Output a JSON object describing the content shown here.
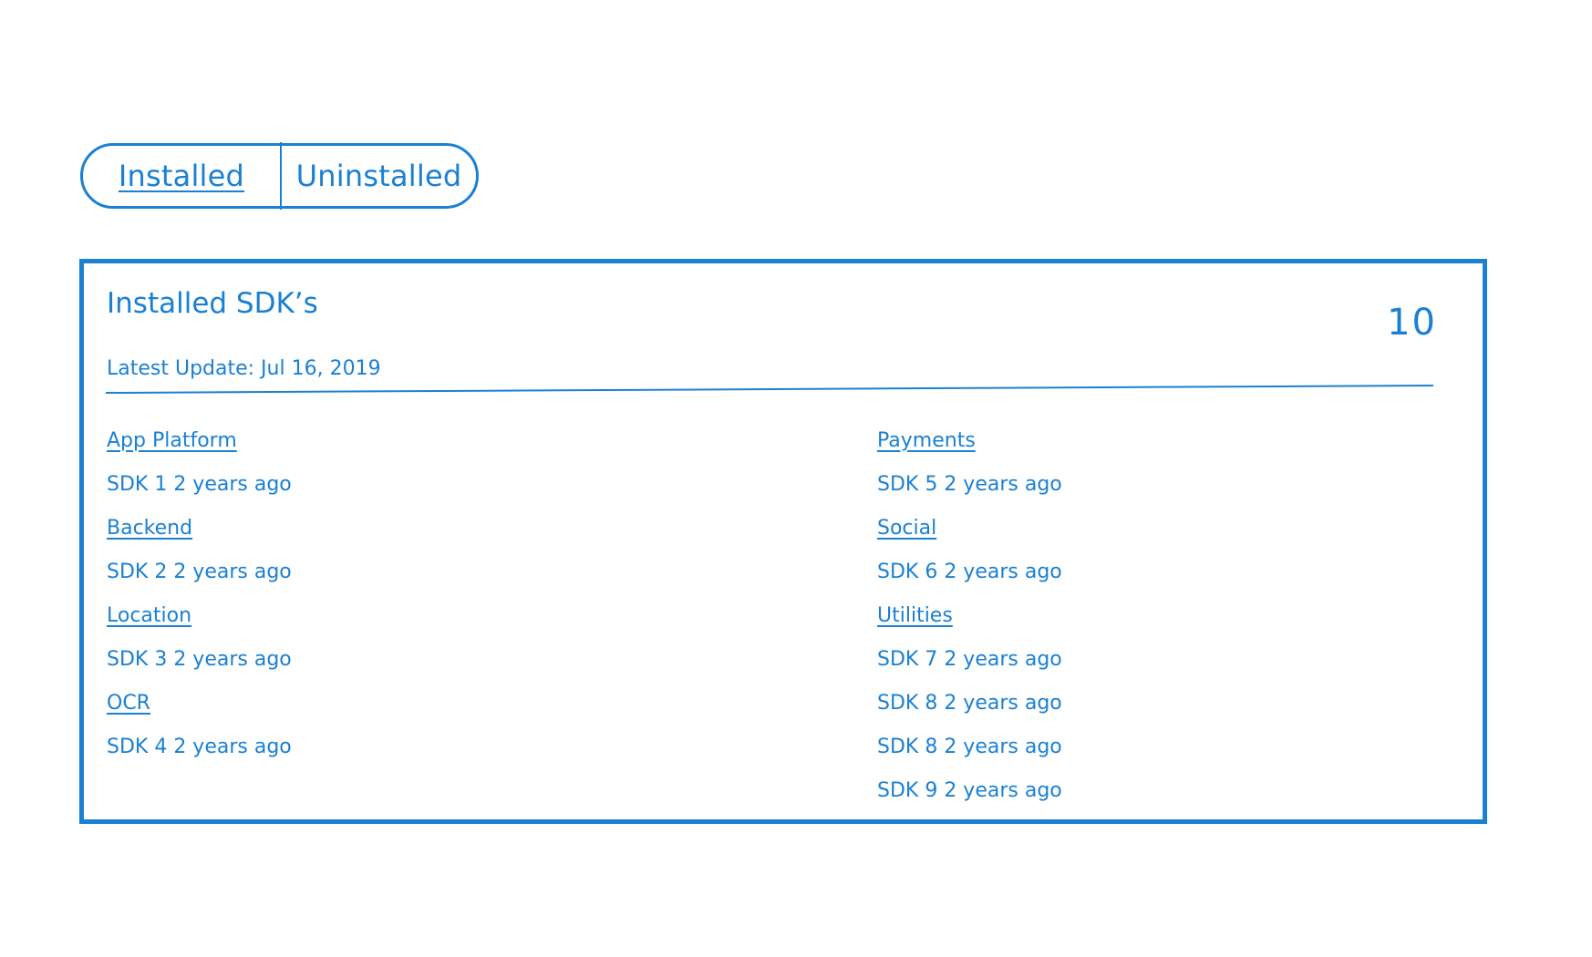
{
  "tabs": {
    "installed_label": "Installed",
    "uninstalled_label": "Uninstalled"
  },
  "card": {
    "title": "Installed SDK’s",
    "count": "10",
    "latest_update": "Latest Update: Jul 16, 2019"
  },
  "left_column": {
    "rows": [
      {
        "type": "category",
        "text": "App Platform"
      },
      {
        "type": "sdk",
        "text": "SDK 1 2 years ago"
      },
      {
        "type": "category",
        "text": "Backend"
      },
      {
        "type": "sdk",
        "text": "SDK 2 2 years ago"
      },
      {
        "type": "category",
        "text": "Location"
      },
      {
        "type": "sdk",
        "text": "SDK 3 2 years ago"
      },
      {
        "type": "category",
        "text": "OCR"
      },
      {
        "type": "sdk",
        "text": "SDK 4 2 years ago"
      }
    ]
  },
  "right_column": {
    "rows": [
      {
        "type": "category",
        "text": "Payments"
      },
      {
        "type": "sdk",
        "text": "SDK 5 2 years ago"
      },
      {
        "type": "category",
        "text": "Social"
      },
      {
        "type": "sdk",
        "text": "SDK 6 2 years ago"
      },
      {
        "type": "category",
        "text": "Utilities"
      },
      {
        "type": "sdk",
        "text": "SDK 7 2 years ago"
      },
      {
        "type": "sdk",
        "text": "SDK 8 2 years ago"
      },
      {
        "type": "sdk",
        "text": "SDK 8 2 years ago"
      },
      {
        "type": "sdk",
        "text": "SDK 9 2 years ago"
      }
    ]
  },
  "colors": {
    "accent": "#1a80d4",
    "background": "#ffffff"
  }
}
